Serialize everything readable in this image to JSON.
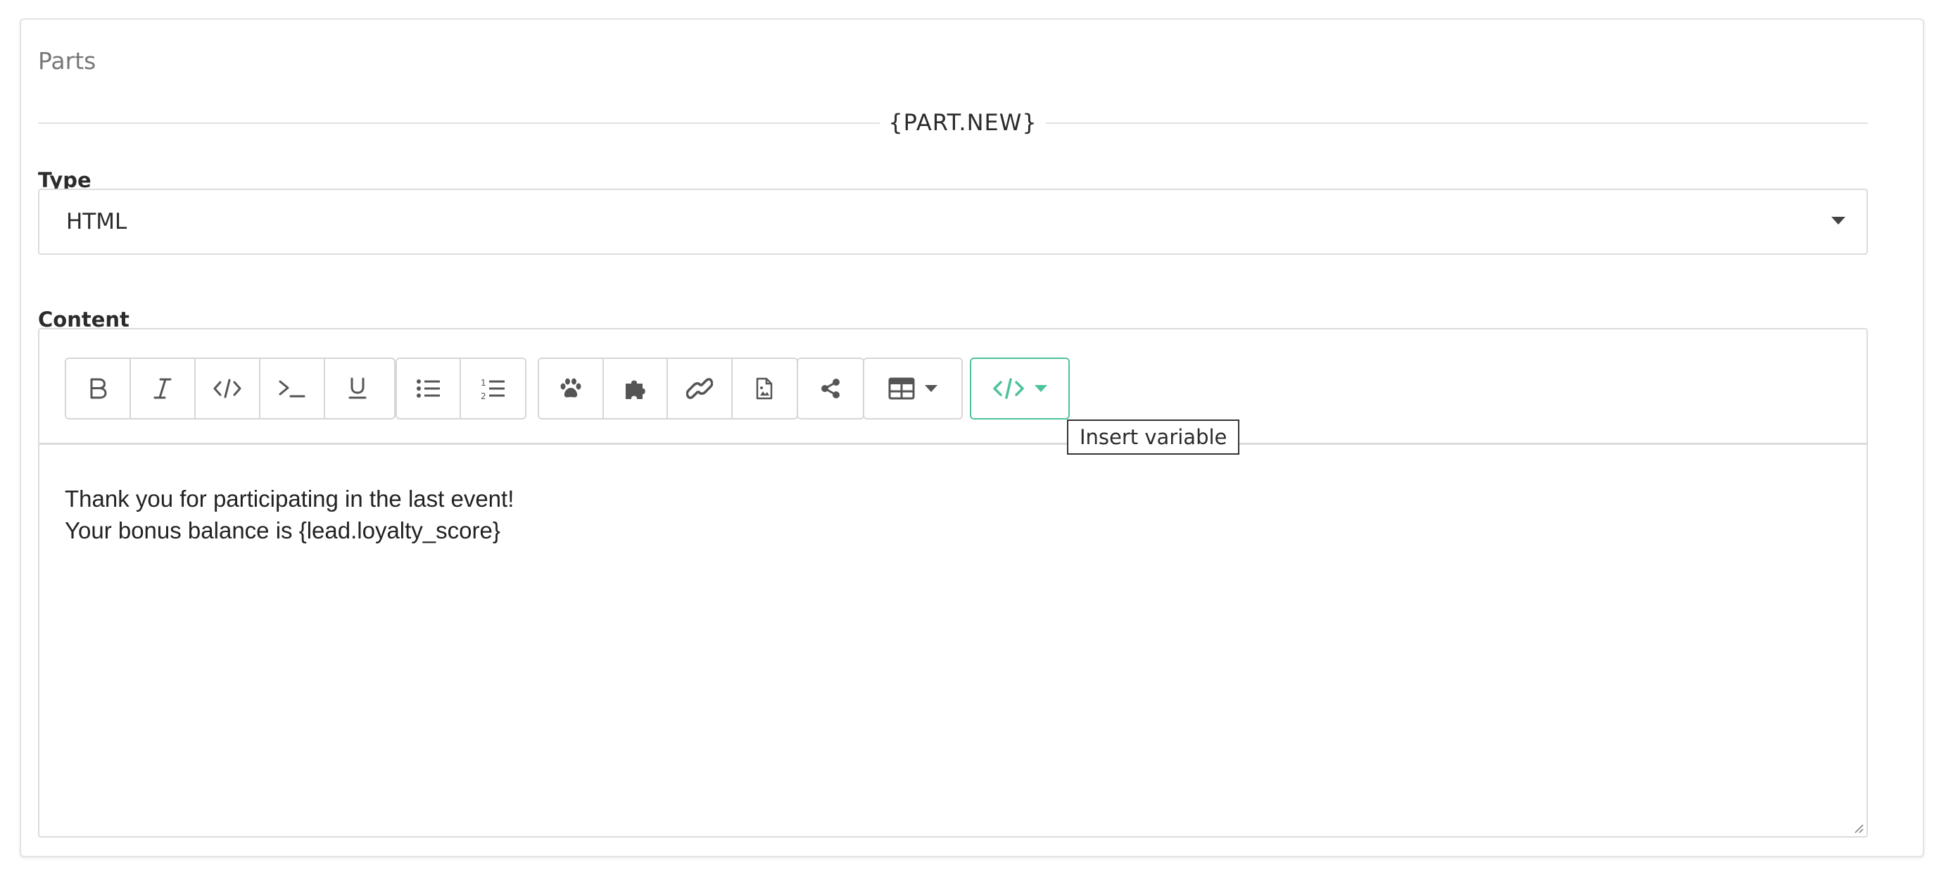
{
  "card": {
    "title": "Parts",
    "part_label": "{PART.NEW}"
  },
  "type_field": {
    "label": "Type",
    "value": "HTML"
  },
  "content_field": {
    "label": "Content",
    "lines": [
      "Thank you for participating in the last event!",
      "Your bonus balance is {lead.loyalty_score}"
    ]
  },
  "toolbar": {
    "groups": [
      [
        "bold-icon",
        "italic-icon",
        "code-icon",
        "terminal-icon",
        "underline-icon"
      ],
      [
        "bulleted-list-icon",
        "numbered-list-icon"
      ],
      [
        "paw-icon",
        "puzzle-icon",
        "link-icon",
        "image-file-icon"
      ],
      [
        "share-icon"
      ],
      [
        "table-icon"
      ],
      [
        "code-variable-icon"
      ]
    ],
    "active_color": "#4cc29a",
    "tooltip": "Insert variable"
  }
}
